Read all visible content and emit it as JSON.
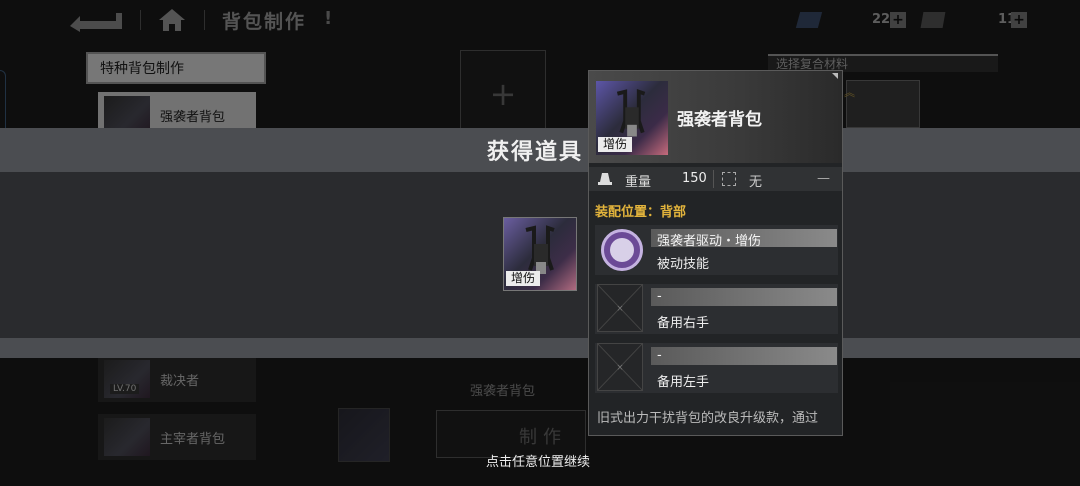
{
  "header": {
    "title": "背包制作",
    "title_mark": "!",
    "resource1_value": "22",
    "resource2_value": "11"
  },
  "sidebar": {
    "category_title": "特种背包制作",
    "items": [
      {
        "label": "强袭者背包"
      },
      {
        "label": "裁决者",
        "level": "LV.70"
      },
      {
        "label": "主宰者背包"
      }
    ]
  },
  "materials": {
    "title": "选择复合材料"
  },
  "craft": {
    "selected_name": "强袭者背包",
    "button_label": "制作"
  },
  "obtain": {
    "title": "获得道具",
    "item_tag": "增伤",
    "continue_hint": "点击任意位置继续"
  },
  "detail": {
    "item_name": "强袭者背包",
    "item_tag": "增伤",
    "weight_label": "重量",
    "weight_value": "150",
    "slot_value": "无",
    "extra_value": "—",
    "equip_position": "装配位置：背部",
    "skills": [
      {
        "name": "强袭者驱动・增伤",
        "type": "被动技能"
      },
      {
        "name": "-",
        "type": "备用右手"
      },
      {
        "name": "-",
        "type": "备用左手"
      }
    ],
    "description": "旧式出力干扰背包的改良升级款，通过"
  }
}
